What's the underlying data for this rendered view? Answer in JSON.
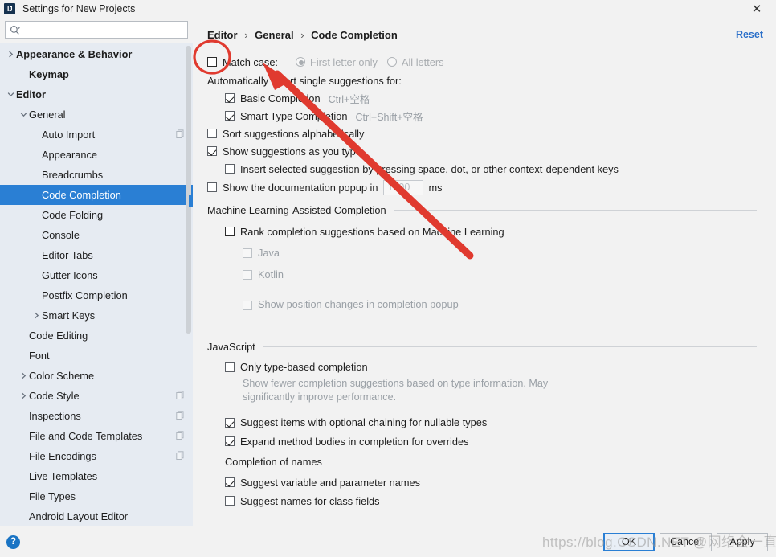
{
  "window": {
    "title": "Settings for New Projects",
    "logo_text": "IJ",
    "close_icon": "close-icon"
  },
  "search": {
    "value": "",
    "placeholder": ""
  },
  "sidebar": {
    "items": [
      {
        "label": "Appearance & Behavior",
        "arrow": "right",
        "bold": true,
        "indent": 0,
        "selected": false,
        "badge": false
      },
      {
        "label": "Keymap",
        "arrow": "none",
        "bold": true,
        "indent": 1,
        "selected": false,
        "badge": false
      },
      {
        "label": "Editor",
        "arrow": "down",
        "bold": true,
        "indent": 0,
        "selected": false,
        "badge": false
      },
      {
        "label": "General",
        "arrow": "down",
        "bold": false,
        "indent": 1,
        "selected": false,
        "badge": false
      },
      {
        "label": "Auto Import",
        "arrow": "none",
        "bold": false,
        "indent": 2,
        "selected": false,
        "badge": true
      },
      {
        "label": "Appearance",
        "arrow": "none",
        "bold": false,
        "indent": 2,
        "selected": false,
        "badge": false
      },
      {
        "label": "Breadcrumbs",
        "arrow": "none",
        "bold": false,
        "indent": 2,
        "selected": false,
        "badge": false
      },
      {
        "label": "Code Completion",
        "arrow": "none",
        "bold": false,
        "indent": 2,
        "selected": true,
        "badge": false
      },
      {
        "label": "Code Folding",
        "arrow": "none",
        "bold": false,
        "indent": 2,
        "selected": false,
        "badge": false
      },
      {
        "label": "Console",
        "arrow": "none",
        "bold": false,
        "indent": 2,
        "selected": false,
        "badge": false
      },
      {
        "label": "Editor Tabs",
        "arrow": "none",
        "bold": false,
        "indent": 2,
        "selected": false,
        "badge": false
      },
      {
        "label": "Gutter Icons",
        "arrow": "none",
        "bold": false,
        "indent": 2,
        "selected": false,
        "badge": false
      },
      {
        "label": "Postfix Completion",
        "arrow": "none",
        "bold": false,
        "indent": 2,
        "selected": false,
        "badge": false
      },
      {
        "label": "Smart Keys",
        "arrow": "right",
        "bold": false,
        "indent": 2,
        "selected": false,
        "badge": false
      },
      {
        "label": "Code Editing",
        "arrow": "none",
        "bold": false,
        "indent": 1,
        "selected": false,
        "badge": false
      },
      {
        "label": "Font",
        "arrow": "none",
        "bold": false,
        "indent": 1,
        "selected": false,
        "badge": false
      },
      {
        "label": "Color Scheme",
        "arrow": "right",
        "bold": false,
        "indent": 1,
        "selected": false,
        "badge": false
      },
      {
        "label": "Code Style",
        "arrow": "right",
        "bold": false,
        "indent": 1,
        "selected": false,
        "badge": true
      },
      {
        "label": "Inspections",
        "arrow": "none",
        "bold": false,
        "indent": 1,
        "selected": false,
        "badge": true
      },
      {
        "label": "File and Code Templates",
        "arrow": "none",
        "bold": false,
        "indent": 1,
        "selected": false,
        "badge": true
      },
      {
        "label": "File Encodings",
        "arrow": "none",
        "bold": false,
        "indent": 1,
        "selected": false,
        "badge": true
      },
      {
        "label": "Live Templates",
        "arrow": "none",
        "bold": false,
        "indent": 1,
        "selected": false,
        "badge": false
      },
      {
        "label": "File Types",
        "arrow": "none",
        "bold": false,
        "indent": 1,
        "selected": false,
        "badge": false
      },
      {
        "label": "Android Layout Editor",
        "arrow": "none",
        "bold": false,
        "indent": 1,
        "selected": false,
        "badge": false
      }
    ]
  },
  "main": {
    "breadcrumb": {
      "part1": "Editor",
      "part2": "General",
      "part3": "Code Completion",
      "separator": "›"
    },
    "reset_label": "Reset",
    "match_case": {
      "label": "Match case:",
      "checked": false,
      "radio_first_letter": "First letter only",
      "radio_all_letters": "All letters",
      "selected_radio": "First letter only"
    },
    "auto_insert_header": "Automatically insert single suggestions for:",
    "auto_insert_items": [
      {
        "label": "Basic Completion",
        "shortcut": "Ctrl+空格",
        "checked": true
      },
      {
        "label": "Smart Type Completion",
        "shortcut": "Ctrl+Shift+空格",
        "checked": true
      }
    ],
    "general_options": [
      {
        "label": "Sort suggestions alphabetically",
        "checked": false
      },
      {
        "label": "Show suggestions as you type",
        "checked": true
      }
    ],
    "insert_selected": {
      "label": "Insert selected suggestion by pressing space, dot, or other context-dependent keys",
      "checked": false
    },
    "doc_popup": {
      "label_before": "Show the documentation popup in",
      "value": "1000",
      "label_after": "ms",
      "checked": false
    },
    "ml_section": {
      "title": "Machine Learning-Assisted Completion",
      "rank_label": "Rank completion suggestions based on Machine Learning",
      "rank_checked": false,
      "sub_items": [
        {
          "label": "Java",
          "checked": false,
          "disabled": true
        },
        {
          "label": "Kotlin",
          "checked": false,
          "disabled": true
        },
        {
          "label": "Show position changes in completion popup",
          "checked": false,
          "disabled": true
        }
      ]
    },
    "js_section": {
      "title": "JavaScript",
      "only_type_based": {
        "label": "Only type-based completion",
        "checked": false
      },
      "only_type_based_hint": "Show fewer completion suggestions based on type information. May significantly improve performance.",
      "options": [
        {
          "label": "Suggest items with optional chaining for nullable types",
          "checked": true
        },
        {
          "label": "Expand method bodies in completion for overrides",
          "checked": true
        }
      ],
      "completion_of_names_label": "Completion of names",
      "name_options": [
        {
          "label": "Suggest variable and parameter names",
          "checked": true
        },
        {
          "label": "Suggest names for class fields",
          "checked": false
        }
      ]
    }
  },
  "bottom": {
    "help_label": "?",
    "ok_label": "OK",
    "cancel_label": "Cancel",
    "apply_label": "Apply"
  },
  "watermark": {
    "text": "https://blog.CSDN.NET @网络会一直存在"
  },
  "colors": {
    "accent": "#2a7fd4",
    "link": "#2a6fc9",
    "annotation": "#e03a2f",
    "sidebar_bg": "#e6ebf2",
    "panel_bg": "#f2f2f2"
  }
}
